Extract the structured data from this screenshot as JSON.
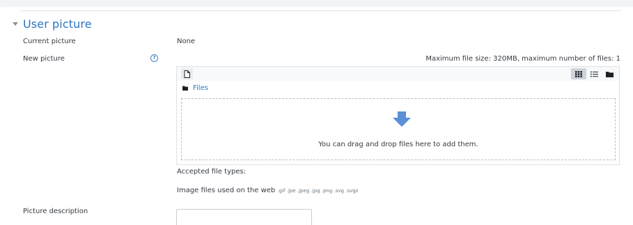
{
  "section": {
    "title": "User picture"
  },
  "current_picture": {
    "label": "Current picture",
    "value": "None"
  },
  "new_picture": {
    "label": "New picture",
    "help_glyph": "?",
    "max_info": "Maximum file size: 320MB, maximum number of files: 1",
    "path_label": "Files",
    "drop_text": "You can drag and drop files here to add them.",
    "accepted_label": "Accepted file types:",
    "accepted_desc": "Image files used on the web",
    "accepted_exts": ".gif .jpe .jpeg .jpg .png .svg .svgz"
  },
  "picture_description": {
    "label": "Picture description",
    "value": ""
  },
  "colors": {
    "accent": "#2a74c4",
    "arrow": "#5b8fd6"
  },
  "icons": {
    "section_toggle": "caret-down-icon",
    "help": "help-icon",
    "add_file": "file-icon",
    "view_icons": "grid-icon",
    "view_list": "list-icon",
    "view_tree": "folder-icon",
    "path": "folder-icon",
    "drop": "arrow-down-icon"
  }
}
